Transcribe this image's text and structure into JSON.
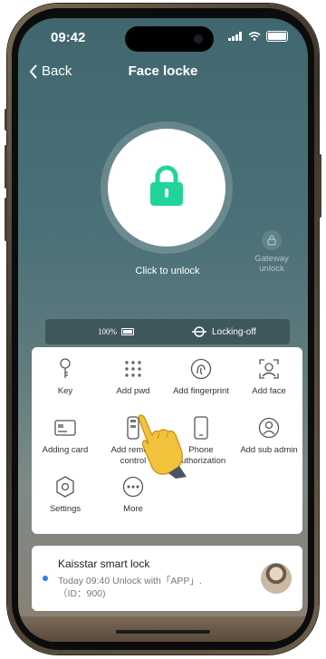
{
  "status_bar": {
    "time": "09:42"
  },
  "nav": {
    "back_label": "Back",
    "title": "Face locke"
  },
  "lock": {
    "click_text": "Click to unlock",
    "accent_color": "#20d49a"
  },
  "gateway": {
    "label_line1": "Gateway",
    "label_line2": "unlock"
  },
  "info_strip": {
    "battery": "100%",
    "lock_status": "Locking-off"
  },
  "menu": {
    "row1": [
      {
        "label": "Key",
        "icon": "key-icon"
      },
      {
        "label": "Add pwd",
        "icon": "keypad-icon"
      },
      {
        "label": "Add fingerprint",
        "icon": "fingerprint-icon"
      },
      {
        "label": "Add face",
        "icon": "face-icon"
      }
    ],
    "row2": [
      {
        "label": "Adding card",
        "icon": "card-icon"
      },
      {
        "label": "Add remote control",
        "icon": "remote-icon"
      },
      {
        "label": "Phone authorization",
        "icon": "phone-icon"
      },
      {
        "label": "Add sub admin",
        "icon": "admin-icon"
      }
    ],
    "row3": [
      {
        "label": "Settings",
        "icon": "settings-icon"
      },
      {
        "label": "More",
        "icon": "more-icon"
      }
    ]
  },
  "record": {
    "name": "Kaisstar smart lock",
    "line1": "Today 09:40  Unlock with「APP」.",
    "line2": "（ID：900)"
  }
}
